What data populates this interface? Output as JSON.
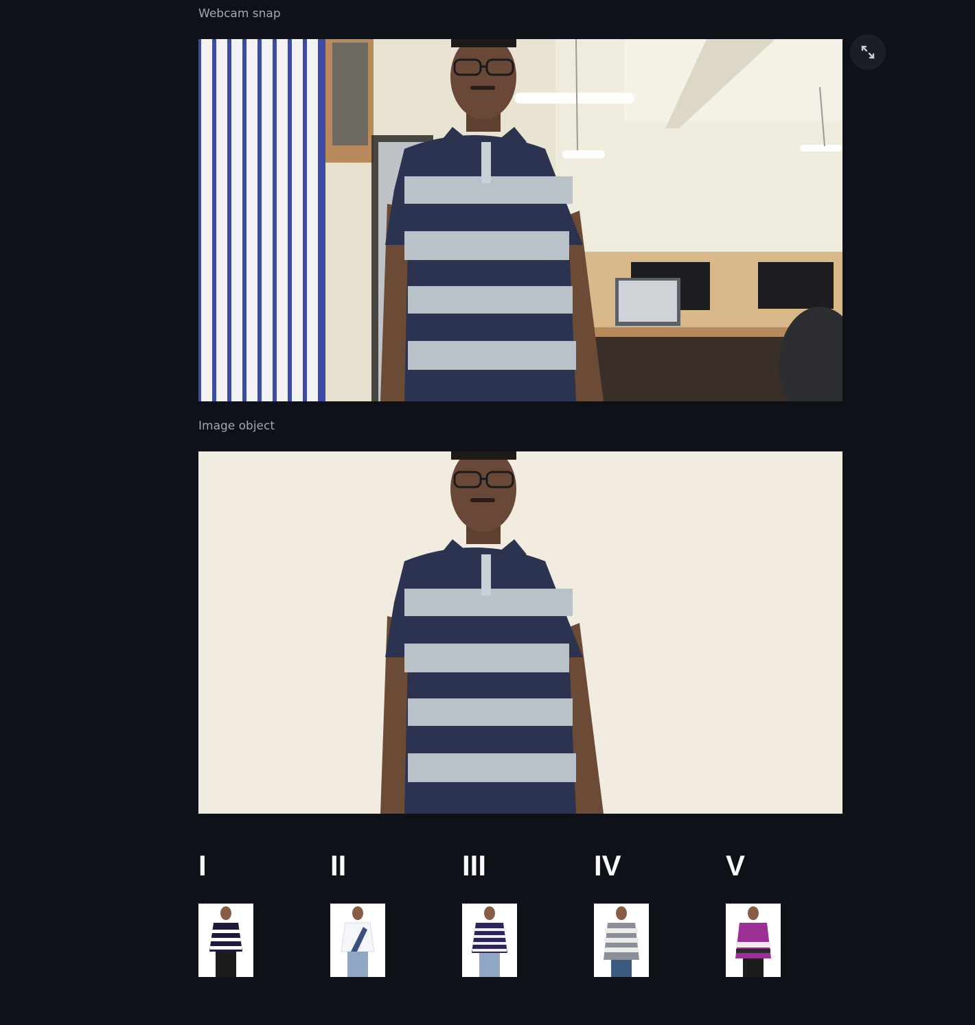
{
  "webcam": {
    "caption": "Webcam snap",
    "expand_icon": "expand-arrows-icon"
  },
  "image_object": {
    "caption": "Image object"
  },
  "recommendations": [
    {
      "label": "I",
      "shirt_color": "#1f1a3a",
      "stripe_color": "#ffffff"
    },
    {
      "label": "II",
      "shirt_color": "#f4f6fa",
      "stripe_color": "#3a4f80"
    },
    {
      "label": "III",
      "shirt_color": "#2e2460",
      "stripe_color": "#f2f2f5"
    },
    {
      "label": "IV",
      "shirt_color": "#8a8f99",
      "stripe_color": "#ecebe6"
    },
    {
      "label": "V",
      "shirt_color": "#9a2f95",
      "stripe_color": "#f0e9ee"
    }
  ],
  "colors": {
    "background": "#0e1117",
    "caption_text": "#a3a8b4",
    "heading_text": "#fafafa",
    "shirt_navy": "#2c3350",
    "shirt_grey": "#b8c2c8",
    "segmented_bg": "#f2ebe0"
  }
}
